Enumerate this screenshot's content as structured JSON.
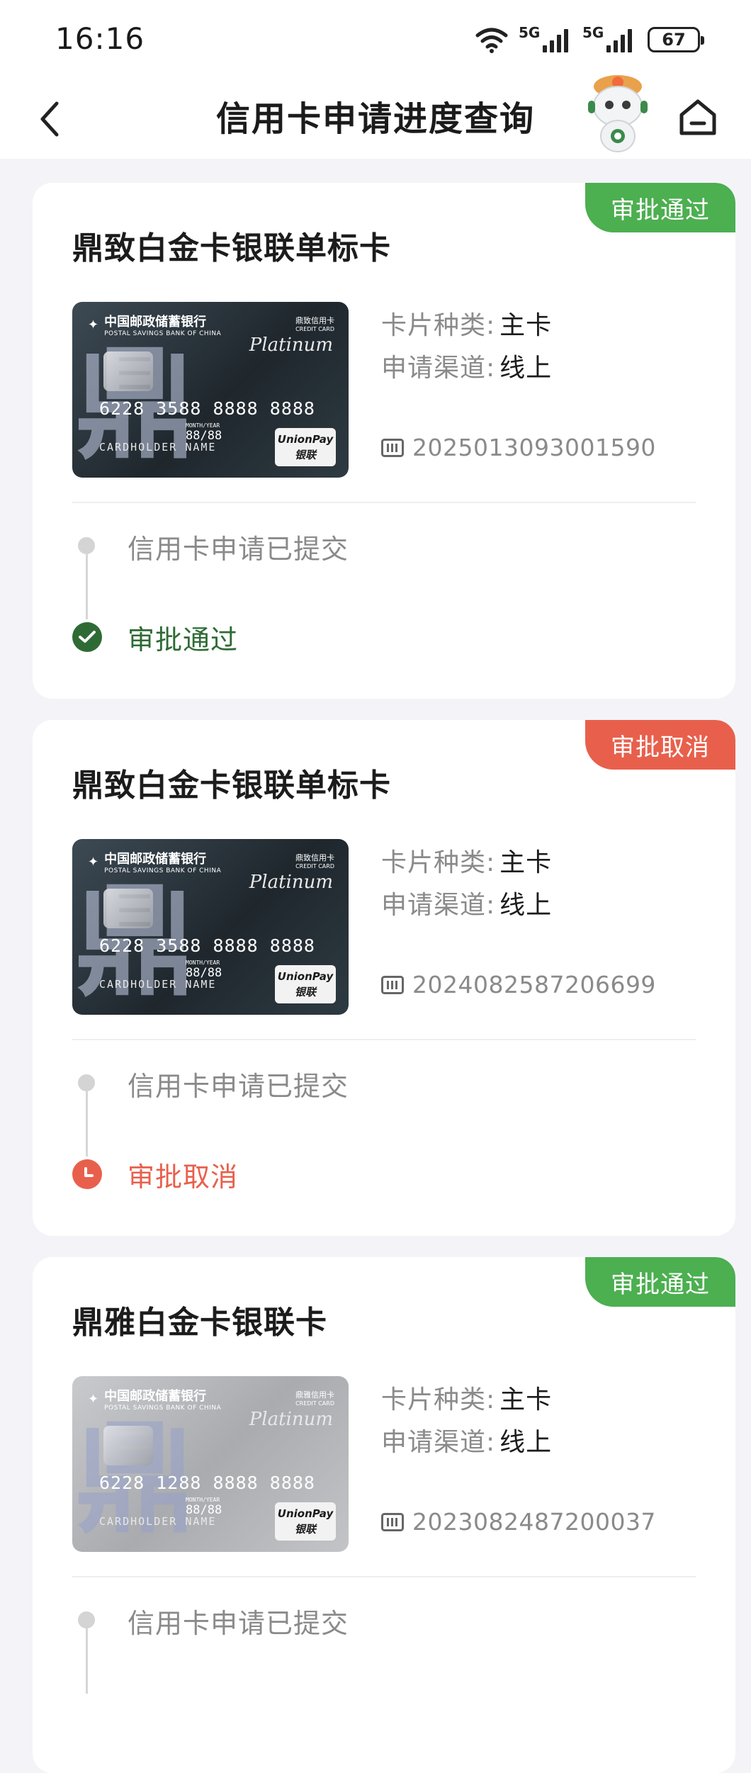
{
  "status": {
    "time": "16:16",
    "net1": "5G",
    "net2": "5G",
    "battery": "67"
  },
  "nav": {
    "title": "信用卡申请进度查询"
  },
  "colors": {
    "approved": "#4caf50",
    "approved_text": "#2e6b34",
    "cancelled": "#e8604c"
  },
  "cards": [
    {
      "badge": "审批通过",
      "badge_status": "approved",
      "title": "鼎致白金卡银联单标卡",
      "card_image": {
        "bank_cn": "中国邮政储蓄银行",
        "bank_en": "POSTAL SAVINGS BANK OF CHINA",
        "card_type": "鼎致信用卡",
        "card_type_en": "CREDIT CARD",
        "tier": "Platinum",
        "number": "6228 3588 8888 8888",
        "valid_label": "MONTH/YEAR",
        "valid": "88/88",
        "holder": "CARDHOLDER NAME",
        "network": "UnionPay",
        "network_cn": "银联"
      },
      "type_label": "卡片种类:",
      "type_value": "主卡",
      "channel_label": "申请渠道:",
      "channel_value": "线上",
      "app_no": "2025013093001590",
      "step1": "信用卡申请已提交",
      "step2": "审批通过"
    },
    {
      "badge": "审批取消",
      "badge_status": "cancelled",
      "title": "鼎致白金卡银联单标卡",
      "card_image": {
        "bank_cn": "中国邮政储蓄银行",
        "bank_en": "POSTAL SAVINGS BANK OF CHINA",
        "card_type": "鼎致信用卡",
        "card_type_en": "CREDIT CARD",
        "tier": "Platinum",
        "number": "6228 3588 8888 8888",
        "valid_label": "MONTH/YEAR",
        "valid": "88/88",
        "holder": "CARDHOLDER NAME",
        "network": "UnionPay",
        "network_cn": "银联"
      },
      "type_label": "卡片种类:",
      "type_value": "主卡",
      "channel_label": "申请渠道:",
      "channel_value": "线上",
      "app_no": "2024082587206699",
      "step1": "信用卡申请已提交",
      "step2": "审批取消"
    },
    {
      "badge": "审批通过",
      "badge_status": "approved",
      "title": "鼎雅白金卡银联卡",
      "card_image": {
        "bank_cn": "中国邮政储蓄银行",
        "bank_en": "POSTAL SAVINGS BANK OF CHINA",
        "card_type": "鼎雅信用卡",
        "card_type_en": "CREDIT CARD",
        "tier": "Platinum",
        "number": "6228 1288 8888 8888",
        "valid_label": "MONTH/YEAR",
        "valid": "88/88",
        "holder": "CARDHOLDER NAME",
        "network": "UnionPay",
        "network_cn": "银联"
      },
      "type_label": "卡片种类:",
      "type_value": "主卡",
      "channel_label": "申请渠道:",
      "channel_value": "线上",
      "app_no": "2023082487200037",
      "step1": "信用卡申请已提交",
      "step2": ""
    }
  ]
}
